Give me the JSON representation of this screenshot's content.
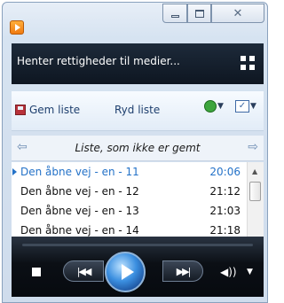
{
  "window": {
    "minimize_icon": "minimize-icon",
    "maximize_icon": "maximize-icon",
    "close_label": "✕"
  },
  "header": {
    "status_text": "Henter rettigheder til medier...",
    "switch_view_icon": "switch-view-icon"
  },
  "toolbar": {
    "save_label": "Gem liste",
    "clear_label": "Ryd liste"
  },
  "listnav": {
    "list_name": "Liste, som ikke er gemt",
    "back_arrow": "⇦",
    "forward_arrow": "⇨"
  },
  "playlist": {
    "items": [
      {
        "title": "Den åbne vej - en - 11",
        "duration": "20:06"
      },
      {
        "title": "Den åbne vej - en - 12",
        "duration": "21:12"
      },
      {
        "title": "Den åbne vej - en - 13",
        "duration": "21:03"
      },
      {
        "title": "Den åbne vej - en - 14",
        "duration": "21:18"
      }
    ]
  },
  "controls": {
    "prev_label": "|◀◀",
    "next_label": "▶▶|",
    "volume_label": "◀))"
  },
  "colors": {
    "accent": "#2472c8",
    "header_bg": "#0e1621",
    "controls_bg": "#070a0f"
  }
}
